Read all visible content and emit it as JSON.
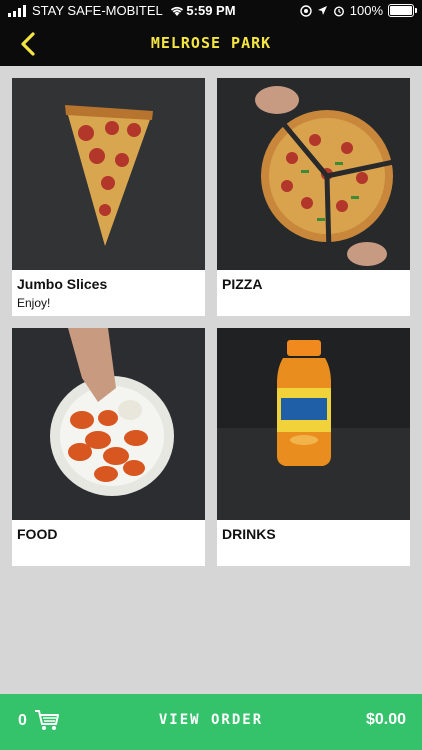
{
  "status_bar": {
    "carrier": "STAY SAFE-MOBITEL",
    "time": "5:59 PM",
    "battery": "100%"
  },
  "header": {
    "title": "MELROSE PARK",
    "back_icon": "chevron-left-icon"
  },
  "categories": [
    {
      "label": "Jumbo Slices",
      "subtitle": "Enjoy!",
      "image": "pepperoni-slice"
    },
    {
      "label": "PIZZA",
      "subtitle": "",
      "image": "sliced-pizza"
    },
    {
      "label": "FOOD",
      "subtitle": "",
      "image": "chicken-wings"
    },
    {
      "label": "DRINKS",
      "subtitle": "",
      "image": "iced-tea-bottle"
    }
  ],
  "order_bar": {
    "count": "0",
    "label": "VIEW ORDER",
    "total": "$0.00",
    "icon": "cart-icon"
  },
  "colors": {
    "header_bg": "#0b0b0b",
    "title": "#f4e542",
    "accent_green": "#34c26b",
    "page_bg": "#d7d6d7"
  }
}
